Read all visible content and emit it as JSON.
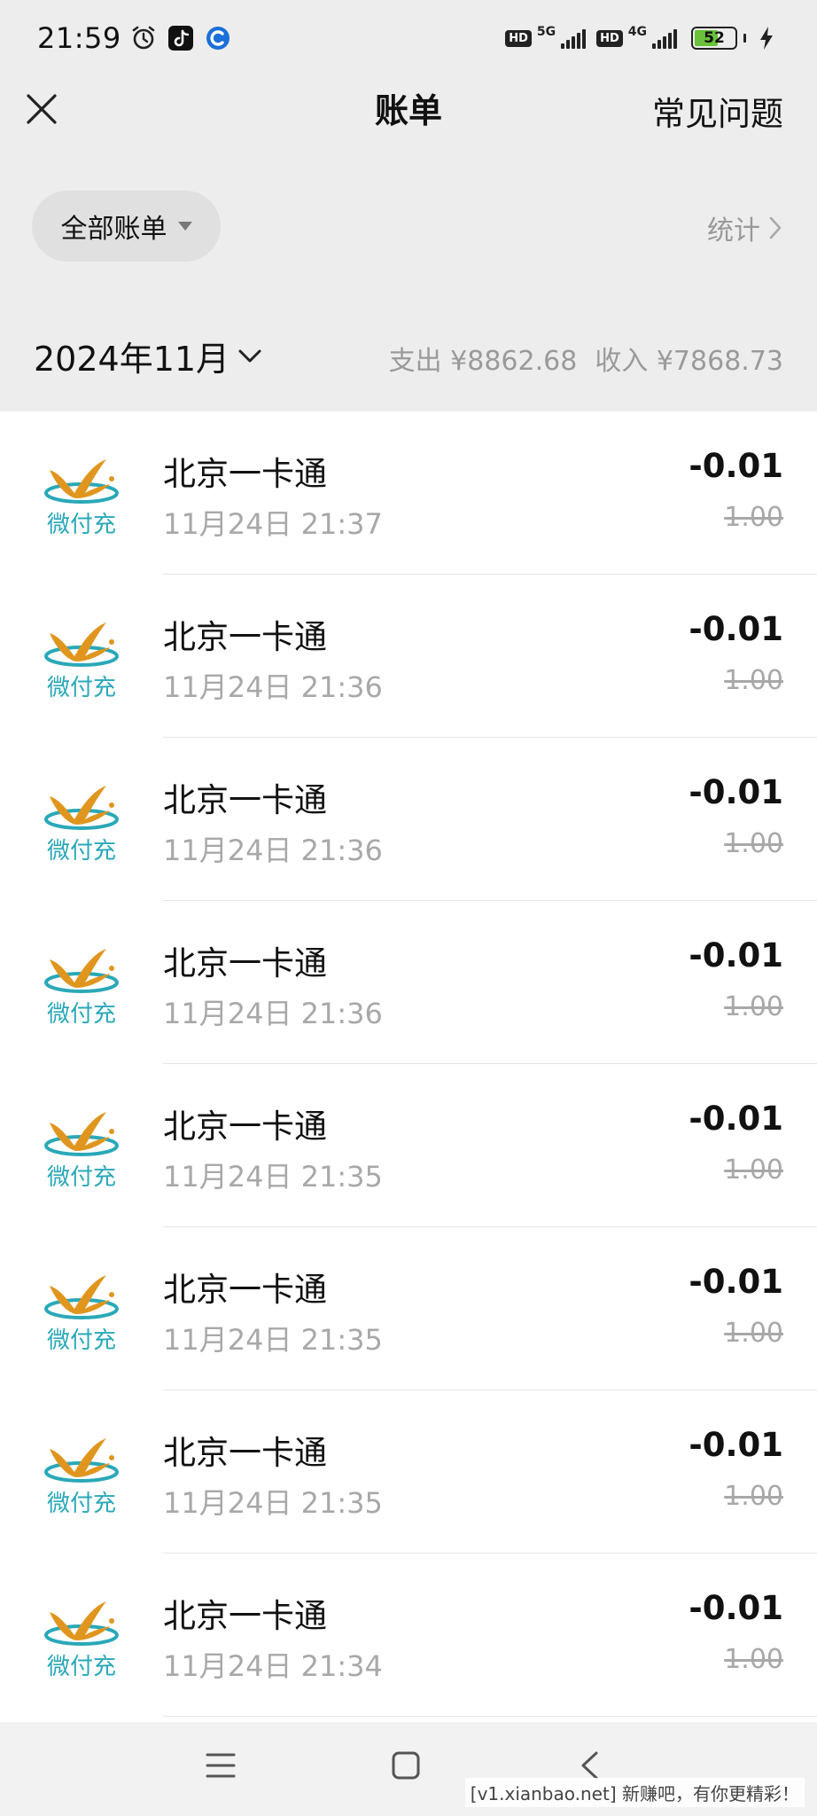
{
  "status_bar": {
    "time": "21:59",
    "net1": "5G",
    "net2": "4G",
    "hd": "HD",
    "battery": "52"
  },
  "nav": {
    "title": "账单",
    "faq": "常见问题"
  },
  "filter": {
    "label": "全部账单",
    "stats": "统计"
  },
  "summary": {
    "month": "2024年11月",
    "expense": "支出 ¥8862.68",
    "income": "收入 ¥7868.73"
  },
  "logo_text": "微付充",
  "transactions": [
    {
      "merchant": "北京一卡通",
      "time": "11月24日 21:37",
      "amount": "-0.01",
      "original": "1.00"
    },
    {
      "merchant": "北京一卡通",
      "time": "11月24日 21:36",
      "amount": "-0.01",
      "original": "1.00"
    },
    {
      "merchant": "北京一卡通",
      "time": "11月24日 21:36",
      "amount": "-0.01",
      "original": "1.00"
    },
    {
      "merchant": "北京一卡通",
      "time": "11月24日 21:36",
      "amount": "-0.01",
      "original": "1.00"
    },
    {
      "merchant": "北京一卡通",
      "time": "11月24日 21:35",
      "amount": "-0.01",
      "original": "1.00"
    },
    {
      "merchant": "北京一卡通",
      "time": "11月24日 21:35",
      "amount": "-0.01",
      "original": "1.00"
    },
    {
      "merchant": "北京一卡通",
      "time": "11月24日 21:35",
      "amount": "-0.01",
      "original": "1.00"
    },
    {
      "merchant": "北京一卡通",
      "time": "11月24日 21:34",
      "amount": "-0.01",
      "original": "1.00"
    }
  ],
  "watermark": "[v1.xianbao.net] 新赚吧，有你更精彩！",
  "colors": {
    "background": "#ededed",
    "list_bg": "#ffffff",
    "logo_gold": "#e0961e",
    "logo_teal": "#2aa8b8"
  }
}
